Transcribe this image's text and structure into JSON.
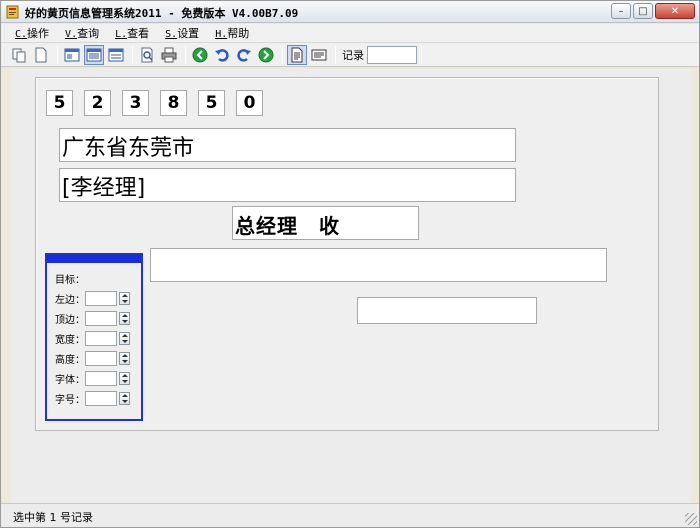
{
  "window": {
    "title": "好的黄页信息管理系统2011 - 免费版本 V4.00B7.09",
    "minimize": "–",
    "maximize": "□",
    "close": "✕"
  },
  "menu": {
    "items": [
      {
        "accel": "C.",
        "label": "操作"
      },
      {
        "accel": "V.",
        "label": "查询"
      },
      {
        "accel": "L.",
        "label": "查看"
      },
      {
        "accel": "S.",
        "label": "设置"
      },
      {
        "accel": "H.",
        "label": "帮助"
      }
    ]
  },
  "toolbar": {
    "icons": [
      "copy-icon",
      "new-page-icon",
      "layout-list-icon",
      "layout-grid-icon",
      "layout-detail-icon",
      "print-preview-icon",
      "printer-icon",
      "back-icon",
      "undo-icon",
      "redo-icon",
      "forward-icon",
      "document-icon",
      "document-text-icon"
    ],
    "record_label": "记录",
    "record_value": ""
  },
  "envelope": {
    "postal_code_digits": [
      "5",
      "2",
      "3",
      "8",
      "5",
      "0"
    ],
    "address": "广东省东莞市",
    "recipient": "[李经理]",
    "title_line": "总经理　收",
    "field_empty_1": "",
    "field_empty_2": ""
  },
  "properties": {
    "target_label": "目标：",
    "rows": [
      {
        "label": "左边：",
        "value": ""
      },
      {
        "label": "顶边：",
        "value": ""
      },
      {
        "label": "宽度：",
        "value": ""
      },
      {
        "label": "高度：",
        "value": ""
      },
      {
        "label": "字体：",
        "value": ""
      },
      {
        "label": "字号：",
        "value": ""
      }
    ]
  },
  "status": {
    "text": "选中第 1 号记录"
  },
  "colors": {
    "panel_border": "#2233cc",
    "panel_header": "#1a2dd4",
    "close_button": "#c8433a"
  }
}
